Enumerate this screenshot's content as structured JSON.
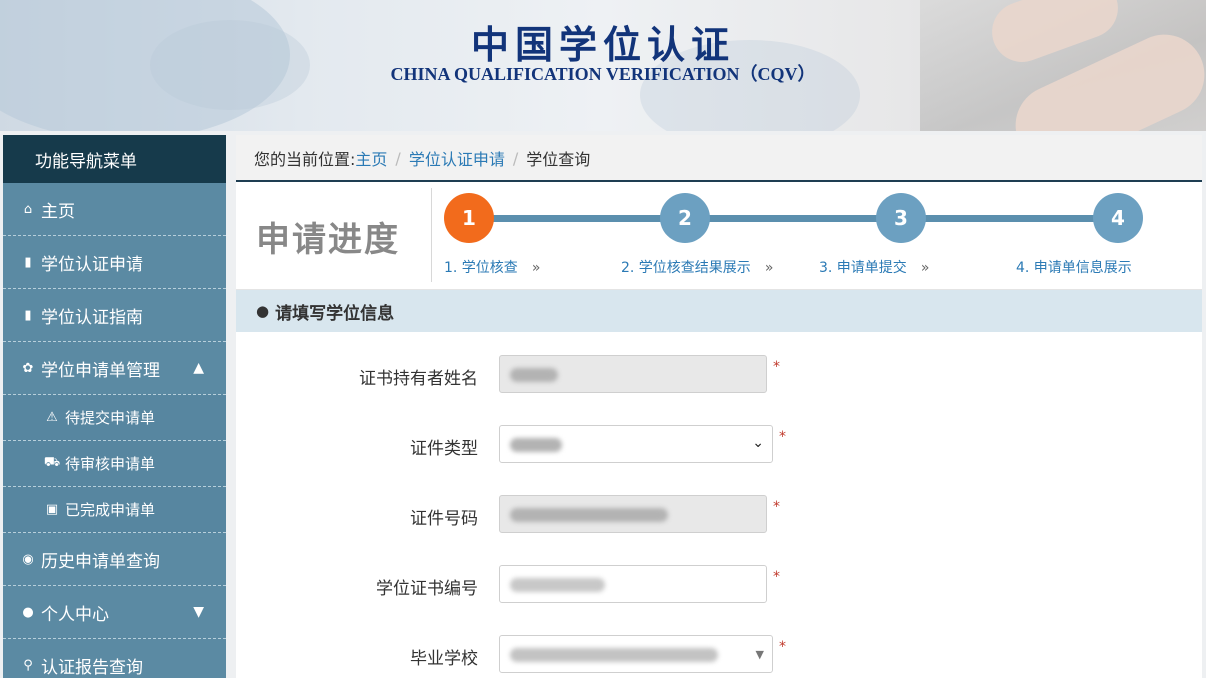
{
  "banner": {
    "title": "中国学位认证",
    "subtitle": "CHINA QUALIFICATION VERIFICATION（CQV）"
  },
  "sidebar": {
    "header": "功能导航菜单",
    "items": [
      {
        "label": "主页",
        "icon": "home-icon"
      },
      {
        "label": "学位认证申请",
        "icon": "file-icon"
      },
      {
        "label": "学位认证指南",
        "icon": "bookmark-icon"
      },
      {
        "label": "学位申请单管理",
        "icon": "gear-icon"
      },
      {
        "label": "历史申请单查询",
        "icon": "camera-icon"
      },
      {
        "label": "个人中心",
        "icon": "user-icon"
      },
      {
        "label": "认证报告查询",
        "icon": "search-icon"
      }
    ],
    "sub_items": [
      {
        "label": "待提交申请单",
        "icon": "warning-icon"
      },
      {
        "label": "待审核申请单",
        "icon": "cart-icon"
      },
      {
        "label": "已完成申请单",
        "icon": "briefcase-icon"
      }
    ]
  },
  "breadcrumb": {
    "prefix": "您的当前位置:",
    "home": "主页",
    "sep": "/",
    "level2": "学位认证申请",
    "current": "学位查询"
  },
  "progress": {
    "title": "申请进度",
    "current_step": 1,
    "steps": [
      {
        "num": "1",
        "label": "1. 学位核查"
      },
      {
        "num": "2",
        "label": "2. 学位核查结果展示"
      },
      {
        "num": "3",
        "label": "3. 申请单提交"
      },
      {
        "num": "4",
        "label": "4. 申请单信息展示"
      }
    ],
    "arrow": "»"
  },
  "form": {
    "section_title": "请填写学位信息",
    "required_mark": "*",
    "fields": [
      {
        "label": "证书持有者姓名",
        "type": "text",
        "readonly": true
      },
      {
        "label": "证件类型",
        "type": "select"
      },
      {
        "label": "证件号码",
        "type": "text",
        "readonly": true
      },
      {
        "label": "学位证书编号",
        "type": "text",
        "readonly": false
      },
      {
        "label": "毕业学校",
        "type": "select"
      }
    ]
  },
  "colors": {
    "brand_navy": "#12347a",
    "sidebar": "#5b8aa3",
    "sidebar_header": "#163a4b",
    "active_step": "#f26b1c",
    "inactive_step": "#6ca0c1",
    "link": "#2b7ab5",
    "required": "#c0392b"
  }
}
